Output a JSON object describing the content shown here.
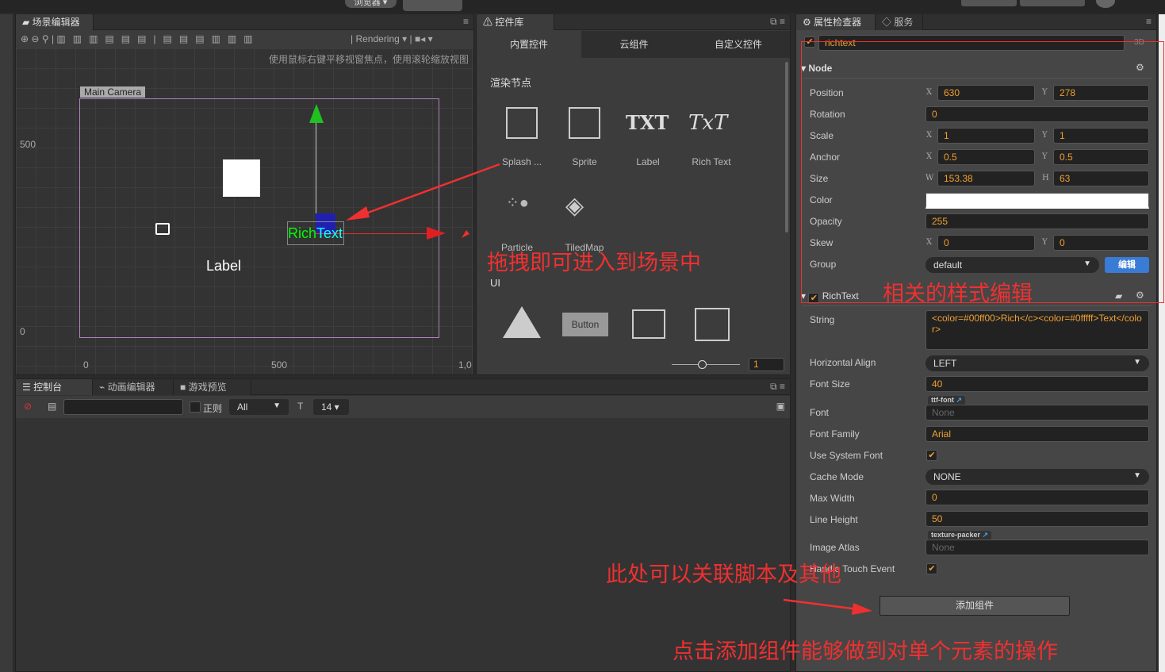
{
  "topbar": {
    "preview_label": "浏览器 ▾"
  },
  "scene": {
    "tab": "场景编辑器",
    "rendering": "Rendering",
    "hint": "使用鼠标右键平移视窗焦点，使用滚轮缩放视图",
    "camera_label": "Main Camera",
    "label_node": "Label",
    "rich_green": "Rich",
    "rich_cyan": "Text",
    "ruler_y": [
      "500",
      "0"
    ],
    "ruler_x": [
      "0",
      "500",
      "1,0"
    ]
  },
  "library": {
    "tabs": [
      "内置控件",
      "云组件",
      "自定义控件"
    ],
    "section1": "渲染节点",
    "items1": [
      "Splash ...",
      "Sprite",
      "Label",
      "Rich Text"
    ],
    "items2": [
      "Particle",
      "TiledMap"
    ],
    "section2": "UI",
    "button_text": "Button",
    "txt1": "TXT",
    "txt2": "TxT",
    "zoom_value": "1"
  },
  "console": {
    "tabs": [
      "控制台",
      "动画编辑器",
      "游戏预览"
    ],
    "regex_label": "正则",
    "filter": "All",
    "font_size": "14 ▾"
  },
  "inspector": {
    "tabs": [
      "属性检查器",
      "服务"
    ],
    "node_name": "richtext",
    "mode": "3D",
    "node_section": "Node",
    "props": {
      "position": {
        "label": "Position",
        "x": "630",
        "y": "278"
      },
      "rotation": {
        "label": "Rotation",
        "value": "0"
      },
      "scale": {
        "label": "Scale",
        "x": "1",
        "y": "1"
      },
      "anchor": {
        "label": "Anchor",
        "x": "0.5",
        "y": "0.5"
      },
      "size": {
        "label": "Size",
        "w": "153.38",
        "h": "63"
      },
      "color": {
        "label": "Color",
        "value": "#ffffff"
      },
      "opacity": {
        "label": "Opacity",
        "value": "255"
      },
      "skew": {
        "label": "Skew",
        "x": "0",
        "y": "0"
      },
      "group": {
        "label": "Group",
        "value": "default",
        "edit": "编辑"
      }
    },
    "richtext_section": "RichText",
    "rt": {
      "string_label": "String",
      "string": "<color=#00ff00>Rich</c><color=#0fffff>Text</color>",
      "halign_label": "Horizontal Align",
      "halign": "LEFT",
      "fontsize_label": "Font Size",
      "fontsize": "40",
      "font_label": "Font",
      "font_tag": "ttf-font",
      "font_value": "None",
      "family_label": "Font Family",
      "family": "Arial",
      "sysfont_label": "Use System Font",
      "cache_label": "Cache Mode",
      "cache": "NONE",
      "maxwidth_label": "Max Width",
      "maxwidth": "0",
      "lineheight_label": "Line Height",
      "lineheight": "50",
      "atlas_label": "Image Atlas",
      "atlas_tag": "texture-packer",
      "atlas_value": "None",
      "touch_label": "Handle Touch Event"
    },
    "add_component": "添加组件"
  },
  "annotations": {
    "drag": "拖拽即可进入到场景中",
    "style": "相关的样式编辑",
    "script": "此处可以关联脚本及其他",
    "add": "点击添加组件能够做到对单个元素的操作",
    "color": "#f03030"
  }
}
